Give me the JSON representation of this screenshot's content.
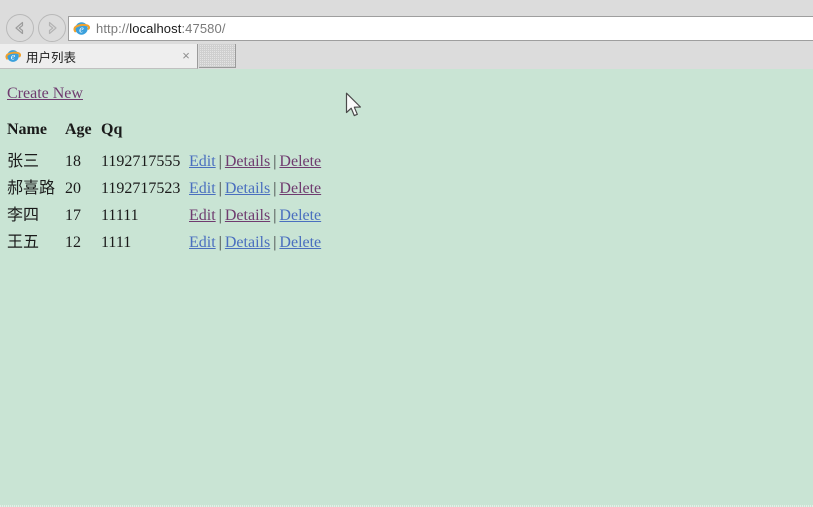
{
  "browser": {
    "back_label": "Back",
    "forward_label": "Forward",
    "address": {
      "scheme_prefix": "http://",
      "host": "localhost",
      "suffix": ":47580/",
      "full_url": "http://localhost:47580/",
      "favicon": "ie-logo-icon"
    },
    "tab": {
      "title": "用户列表",
      "favicon": "ie-logo-icon",
      "close_label": "×"
    },
    "new_tab_label": ""
  },
  "page": {
    "create_new_label": "Create New",
    "table": {
      "headers": [
        "Name",
        "Age",
        "Qq"
      ],
      "actions": {
        "edit_label": "Edit",
        "details_label": "Details",
        "delete_label": "Delete",
        "separator": "|"
      },
      "rows": [
        {
          "name": "张三",
          "age": "18",
          "qq": "1192717555",
          "edit_state": "unvisited",
          "details_state": "visited",
          "delete_state": "visited"
        },
        {
          "name": "郝喜路",
          "age": "20",
          "qq": "1192717523",
          "edit_state": "unvisited",
          "details_state": "unvisited",
          "delete_state": "visited"
        },
        {
          "name": "李四",
          "age": "17",
          "qq": "11111",
          "edit_state": "visited",
          "details_state": "visited",
          "delete_state": "unvisited"
        },
        {
          "name": "王五",
          "age": "12",
          "qq": "1111",
          "edit_state": "unvisited",
          "details_state": "unvisited",
          "delete_state": "unvisited"
        }
      ]
    }
  },
  "colors": {
    "page_background": "#c9e4d4",
    "chrome_background": "#dcdcdc",
    "link_unvisited": "#4a6fbf",
    "link_visited": "#6f3b6f",
    "text": "#1a1a1a"
  }
}
